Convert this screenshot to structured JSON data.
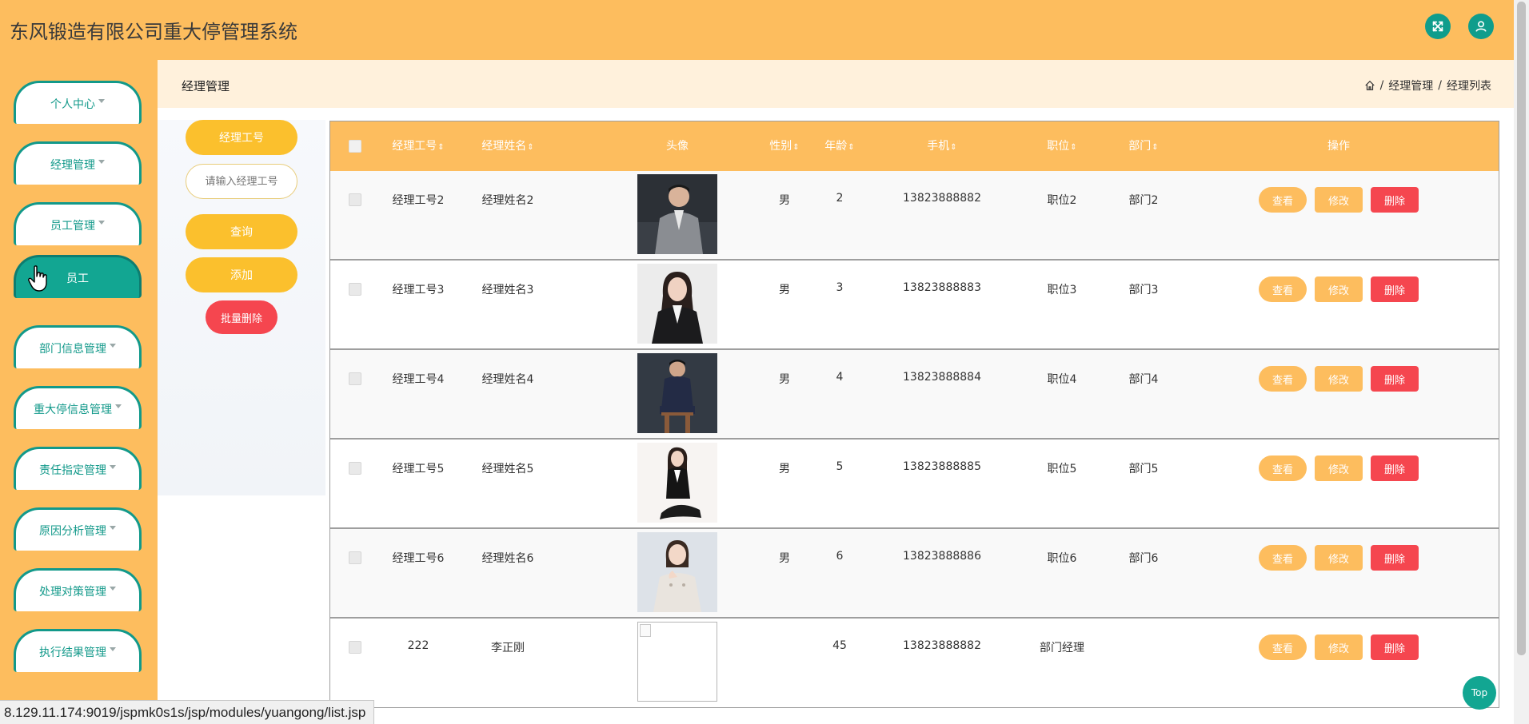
{
  "app": {
    "title": "东风锻造有限公司重大停管理系统"
  },
  "header": {
    "fullscreen_icon": "expand-icon",
    "user_icon": "user-icon"
  },
  "sidebar": {
    "items": [
      {
        "label": "个人中心",
        "has_caret": true,
        "active": false
      },
      {
        "label": "经理管理",
        "has_caret": true,
        "active": false
      },
      {
        "label": "员工管理",
        "has_caret": true,
        "active": false
      },
      {
        "label": "员工",
        "has_caret": false,
        "active": true
      },
      {
        "label": "部门信息管理",
        "has_caret": true,
        "active": false
      },
      {
        "label": "重大停信息管理",
        "has_caret": true,
        "active": false
      },
      {
        "label": "责任指定管理",
        "has_caret": true,
        "active": false
      },
      {
        "label": "原因分析管理",
        "has_caret": true,
        "active": false
      },
      {
        "label": "处理对策管理",
        "has_caret": true,
        "active": false
      },
      {
        "label": "执行结果管理",
        "has_caret": true,
        "active": false
      }
    ]
  },
  "page": {
    "title": "经理管理",
    "breadcrumb": [
      "经理管理",
      "经理列表"
    ]
  },
  "search": {
    "field_label": "经理工号",
    "placeholder": "请输入经理工号",
    "query_label": "查询",
    "add_label": "添加",
    "batch_delete_label": "批量删除"
  },
  "table": {
    "columns": [
      "经理工号",
      "经理姓名",
      "头像",
      "性别",
      "年龄",
      "手机",
      "职位",
      "部门",
      "操作"
    ],
    "rows": [
      {
        "id": "经理工号2",
        "name": "经理姓名2",
        "gender": "男",
        "age": "2",
        "phone": "13823888882",
        "position": "职位2",
        "dept": "部门2",
        "avatar": "man-grey-suit"
      },
      {
        "id": "经理工号3",
        "name": "经理姓名3",
        "gender": "男",
        "age": "3",
        "phone": "13823888883",
        "position": "职位3",
        "dept": "部门3",
        "avatar": "woman-black-suit"
      },
      {
        "id": "经理工号4",
        "name": "经理姓名4",
        "gender": "男",
        "age": "4",
        "phone": "13823888884",
        "position": "职位4",
        "dept": "部门4",
        "avatar": "man-navy-suit"
      },
      {
        "id": "经理工号5",
        "name": "经理姓名5",
        "gender": "男",
        "age": "5",
        "phone": "13823888885",
        "position": "职位5",
        "dept": "部门5",
        "avatar": "woman-sitting"
      },
      {
        "id": "经理工号6",
        "name": "经理姓名6",
        "gender": "男",
        "age": "6",
        "phone": "13823888886",
        "position": "职位6",
        "dept": "部门6",
        "avatar": "woman-light-dress"
      },
      {
        "id": "222",
        "name": "李正刚",
        "gender": "",
        "age": "45",
        "phone": "13823888882",
        "position": "部门经理",
        "dept": "",
        "avatar": "broken-image"
      }
    ],
    "actions": {
      "view": "查看",
      "edit": "修改",
      "delete": "删除"
    }
  },
  "top_button": "Top",
  "status_url": "8.129.11.174:9019/jspmk0s1s/jsp/modules/yuangong/list.jsp",
  "colors": {
    "accent": "#fdbd5e",
    "teal": "#12998a",
    "danger": "#f5464f",
    "yellow": "#fbc02d"
  }
}
